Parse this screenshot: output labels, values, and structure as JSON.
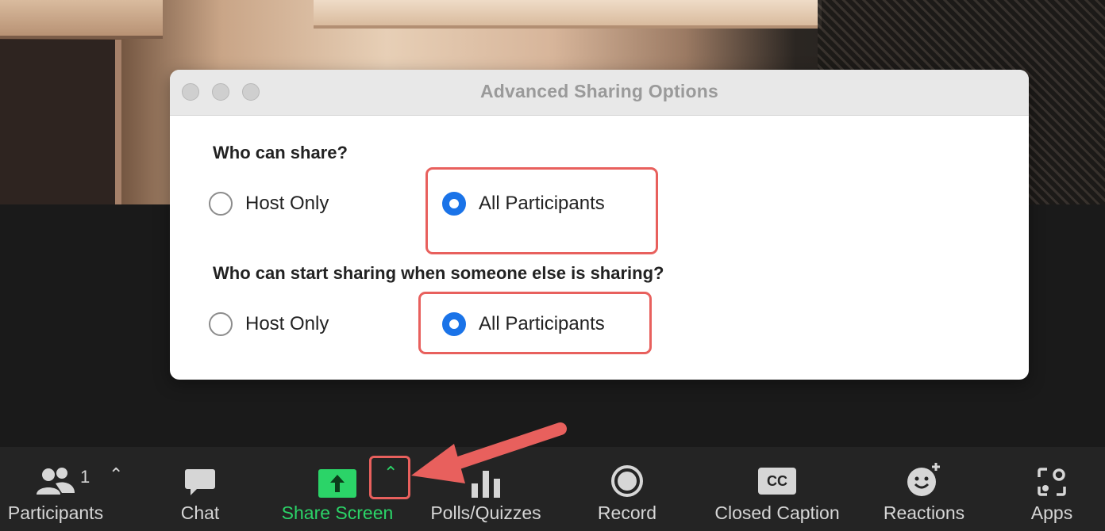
{
  "dialog": {
    "title": "Advanced Sharing Options",
    "sections": [
      {
        "question": "Who can share?",
        "options": [
          {
            "label": "Host Only",
            "selected": false
          },
          {
            "label": "All Participants",
            "selected": true
          }
        ]
      },
      {
        "question": "Who can start sharing when someone else is sharing?",
        "options": [
          {
            "label": "Host Only",
            "selected": false
          },
          {
            "label": "All Participants",
            "selected": true
          }
        ]
      }
    ]
  },
  "toolbar": {
    "participants_count": "1",
    "items": [
      {
        "label": "Participants",
        "icon": "participants-icon"
      },
      {
        "label": "Chat",
        "icon": "chat-icon"
      },
      {
        "label": "Share Screen",
        "icon": "share-screen-icon"
      },
      {
        "label": "Polls/Quizzes",
        "icon": "polls-icon"
      },
      {
        "label": "Record",
        "icon": "record-icon"
      },
      {
        "label": "Closed Caption",
        "icon": "closed-caption-icon",
        "icon_text": "CC"
      },
      {
        "label": "Reactions",
        "icon": "reactions-icon"
      },
      {
        "label": "Apps",
        "icon": "apps-icon"
      }
    ]
  },
  "colors": {
    "accent_blue": "#1a73e8",
    "share_green": "#2bd468",
    "annotation_red": "#e8605d",
    "toolbar_bg": "#242424"
  }
}
